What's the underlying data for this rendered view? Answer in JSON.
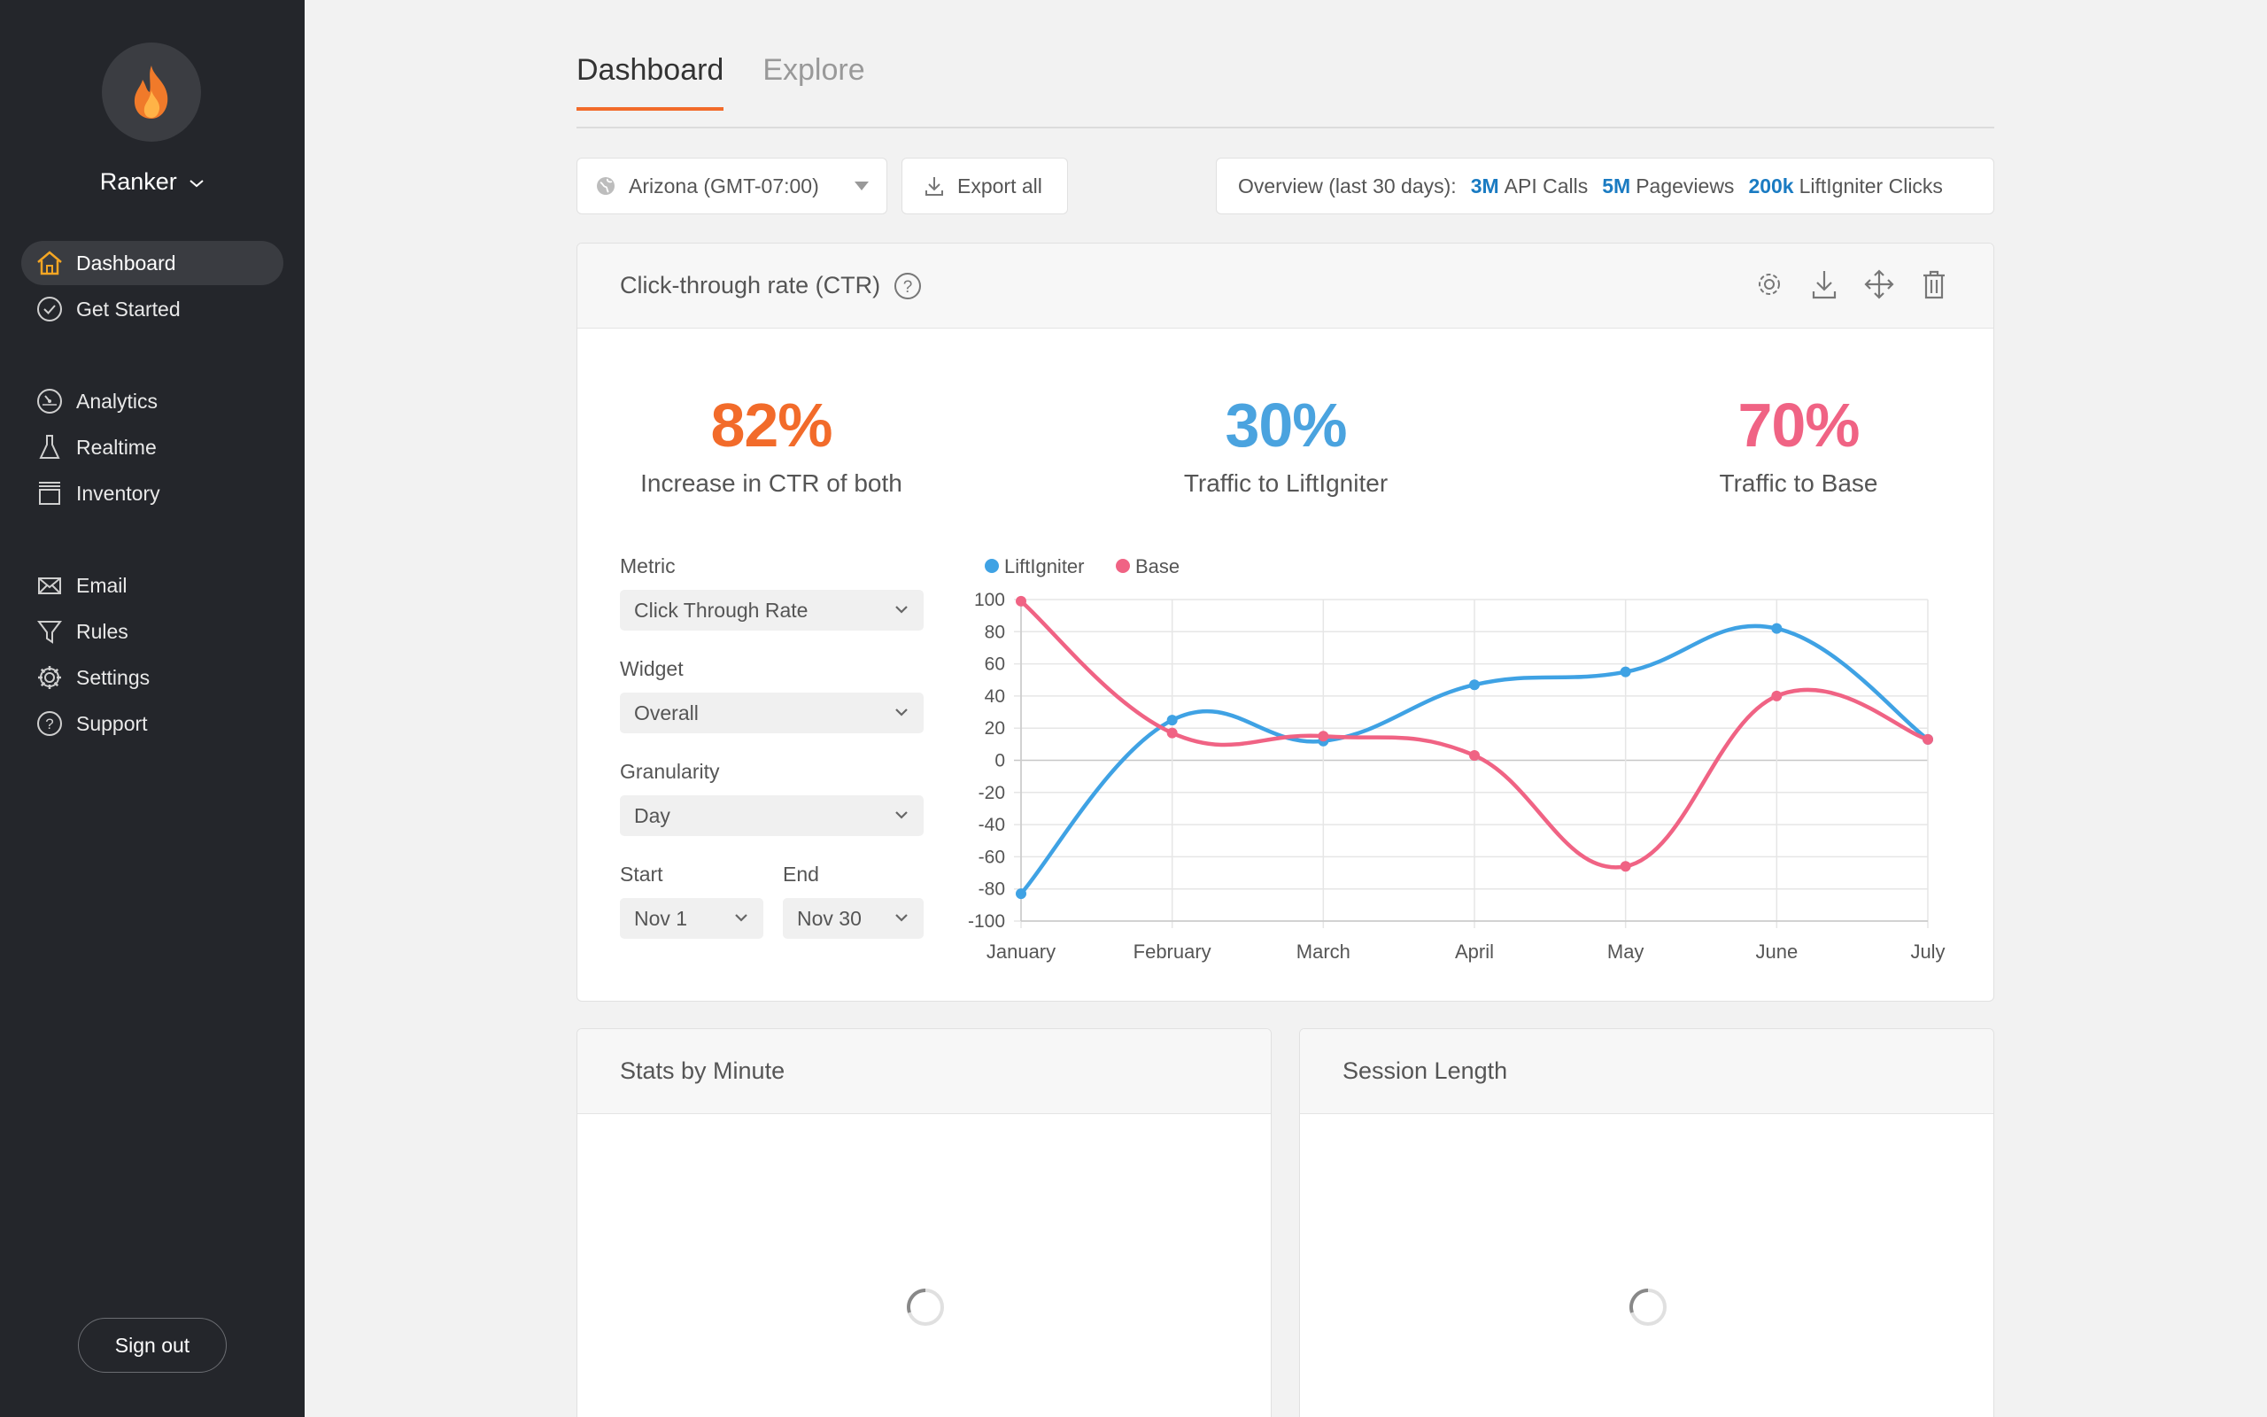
{
  "sidebar": {
    "org_name": "Ranker",
    "items": [
      {
        "label": "Dashboard",
        "icon": "home-icon",
        "active": true
      },
      {
        "label": "Get Started",
        "icon": "check-circle-icon"
      },
      {
        "label": "Analytics",
        "icon": "gauge-icon"
      },
      {
        "label": "Realtime",
        "icon": "flask-icon"
      },
      {
        "label": "Inventory",
        "icon": "box-icon"
      },
      {
        "label": "Email",
        "icon": "mail-icon"
      },
      {
        "label": "Rules",
        "icon": "filter-icon"
      },
      {
        "label": "Settings",
        "icon": "gear-icon"
      },
      {
        "label": "Support",
        "icon": "help-icon"
      }
    ],
    "sign_out": "Sign out"
  },
  "tabs": [
    {
      "label": "Dashboard",
      "active": true
    },
    {
      "label": "Explore",
      "active": false
    }
  ],
  "toolbar": {
    "timezone": "Arizona (GMT-07:00)",
    "export_label": "Export all",
    "overview_label": "Overview (last 30 days):",
    "stats": [
      {
        "value": "3M",
        "label": "API Calls"
      },
      {
        "value": "5M",
        "label": "Pageviews"
      },
      {
        "value": "200k",
        "label": "LiftIgniter Clicks"
      }
    ]
  },
  "ctr_card": {
    "title": "Click-through rate (CTR)",
    "kpis": [
      {
        "value": "82%",
        "label": "Increase in CTR of both",
        "color": "#f26b2a"
      },
      {
        "value": "30%",
        "label": "Traffic to LiftIgniter",
        "color": "#4aa3df"
      },
      {
        "value": "70%",
        "label": "Traffic to Base",
        "color": "#f06384"
      }
    ],
    "filters": {
      "metric_label": "Metric",
      "metric_value": "Click Through Rate",
      "widget_label": "Widget",
      "widget_value": "Overall",
      "granularity_label": "Granularity",
      "granularity_value": "Day",
      "start_label": "Start",
      "start_value": "Nov 1",
      "end_label": "End",
      "end_value": "Nov 30"
    }
  },
  "chart_data": {
    "type": "line",
    "categories": [
      "January",
      "February",
      "March",
      "April",
      "May",
      "June",
      "July"
    ],
    "series": [
      {
        "name": "LiftIgniter",
        "color": "#3fa2e4",
        "values": [
          -83,
          25,
          12,
          47,
          55,
          82,
          13
        ]
      },
      {
        "name": "Base",
        "color": "#f06384",
        "values": [
          99,
          17,
          15,
          3,
          -66,
          40,
          13
        ]
      }
    ],
    "ylim": [
      -100,
      100
    ],
    "yticks": [
      100,
      80,
      60,
      40,
      20,
      0,
      -20,
      -40,
      -60,
      -80,
      -100
    ],
    "grid": true,
    "legend": "top-left"
  },
  "stats_card": {
    "title": "Stats by Minute"
  },
  "session_card": {
    "title": "Session Length"
  }
}
